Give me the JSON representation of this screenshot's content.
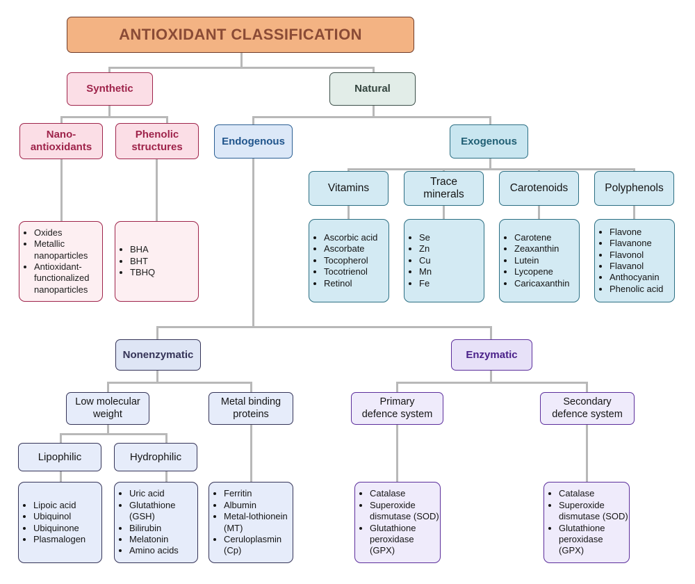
{
  "diagram": {
    "title": "ANTIOXIDANT CLASSIFICATION",
    "type": "hierarchical-tree"
  },
  "nodes": {
    "root": {
      "label": "ANTIOXIDANT CLASSIFICATION"
    },
    "synthetic": {
      "label": "Synthetic"
    },
    "natural": {
      "label": "Natural"
    },
    "nano_antioxidants": {
      "label": "Nano-\nantioxidants"
    },
    "phenolic_structures": {
      "label": "Phenolic\nstructures"
    },
    "endogenous": {
      "label": "Endogenous"
    },
    "exogenous": {
      "label": "Exogenous"
    },
    "vitamins": {
      "label": "Vitamins"
    },
    "trace_minerals": {
      "label": "Trace\nminerals"
    },
    "carotenoids": {
      "label": "Carotenoids"
    },
    "polyphenols": {
      "label": "Polyphenols"
    },
    "nonenzymatic": {
      "label": "Nonenzymatic"
    },
    "enzymatic": {
      "label": "Enzymatic"
    },
    "low_molecular_weight": {
      "label": "Low molecular\nweight"
    },
    "metal_binding_proteins": {
      "label": "Metal binding\nproteins"
    },
    "primary_defence_system": {
      "label": "Primary\ndefence system"
    },
    "secondary_defence_system": {
      "label": "Secondary\ndefence system"
    },
    "lipophilic": {
      "label": "Lipophilic"
    },
    "hydrophilic": {
      "label": "Hydrophilic"
    }
  },
  "lists": {
    "nano_antioxidants_items": [
      "Oxides",
      "Metallic nanoparticles",
      "Antioxidant-functionalized nanoparticles"
    ],
    "phenolic_structures_items": [
      "BHA",
      "BHT",
      "TBHQ"
    ],
    "vitamins_items": [
      "Ascorbic acid",
      "Ascorbate",
      "Tocopherol",
      "Tocotrienol",
      "Retinol"
    ],
    "trace_minerals_items": [
      "Se",
      "Zn",
      "Cu",
      "Mn",
      "Fe"
    ],
    "carotenoids_items": [
      "Carotene",
      "Zeaxanthin",
      "Lutein",
      "Lycopene",
      "Caricaxanthin"
    ],
    "polyphenols_items": [
      "Flavone",
      "Flavanone",
      "Flavonol",
      "Flavanol",
      "Anthocyanin",
      "Phenolic acid"
    ],
    "lipophilic_items": [
      "Lipoic acid",
      "Ubiquinol",
      "Ubiquinone",
      "Plasmalogen"
    ],
    "hydrophilic_items": [
      "Uric acid",
      "Glutathione (GSH)",
      "Bilirubin",
      "Melatonin",
      "Amino acids"
    ],
    "metal_binding_proteins_items": [
      "Ferritin",
      "Albumin",
      "Metal-lothionein (MT)",
      "Ceruloplasmin (Cp)"
    ],
    "primary_defence_items": [
      "Catalase",
      "Superoxide dismutase (SOD)",
      "Glutathione peroxidase (GPX)"
    ],
    "secondary_defence_items": [
      "Catalase",
      "Superoxide dismutase (SOD)",
      "Glutathione peroxidase (GPX)"
    ]
  },
  "colors": {
    "title_fill": "#F3B383",
    "title_border": "#6E3A28",
    "title_text": "#8A4B36",
    "synthetic_fill": "#FBDEE6",
    "synthetic_border": "#9E234A",
    "natural_fill": "#E2EDE8",
    "natural_border": "#3C4F49",
    "endogenous_fill": "#DCE8F8",
    "endogenous_border": "#2A5E93",
    "exogenous_fill": "#C9E6F0",
    "exogenous_border": "#2B6E82",
    "nonenzymatic_fill": "#DEE5F5",
    "nonenzymatic_border": "#343357",
    "enzymatic_fill": "#E7E1F8",
    "enzymatic_border": "#5B2D9B",
    "connector": "#B8B8B8"
  }
}
